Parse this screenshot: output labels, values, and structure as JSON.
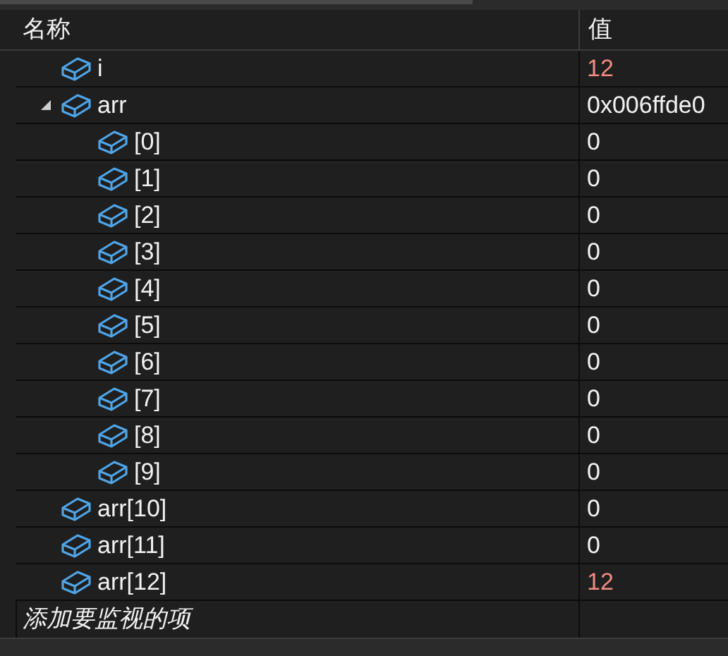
{
  "columns": [
    "名称",
    "值"
  ],
  "items": [
    {
      "name": "i",
      "value": "12",
      "changed": true
    },
    {
      "name": "arr",
      "value": "0x006ffde0",
      "changed": false,
      "expanded": true,
      "children": [
        {
          "name": "[0]",
          "value": "0",
          "changed": false
        },
        {
          "name": "[1]",
          "value": "0",
          "changed": false
        },
        {
          "name": "[2]",
          "value": "0",
          "changed": false
        },
        {
          "name": "[3]",
          "value": "0",
          "changed": false
        },
        {
          "name": "[4]",
          "value": "0",
          "changed": false
        },
        {
          "name": "[5]",
          "value": "0",
          "changed": false
        },
        {
          "name": "[6]",
          "value": "0",
          "changed": false
        },
        {
          "name": "[7]",
          "value": "0",
          "changed": false
        },
        {
          "name": "[8]",
          "value": "0",
          "changed": false
        },
        {
          "name": "[9]",
          "value": "0",
          "changed": false
        }
      ]
    },
    {
      "name": "arr[10]",
      "value": "0",
      "changed": false
    },
    {
      "name": "arr[11]",
      "value": "0",
      "changed": false
    },
    {
      "name": "arr[12]",
      "value": "12",
      "changed": true
    }
  ],
  "add_row": {
    "placeholder": "添加要监视的项"
  }
}
